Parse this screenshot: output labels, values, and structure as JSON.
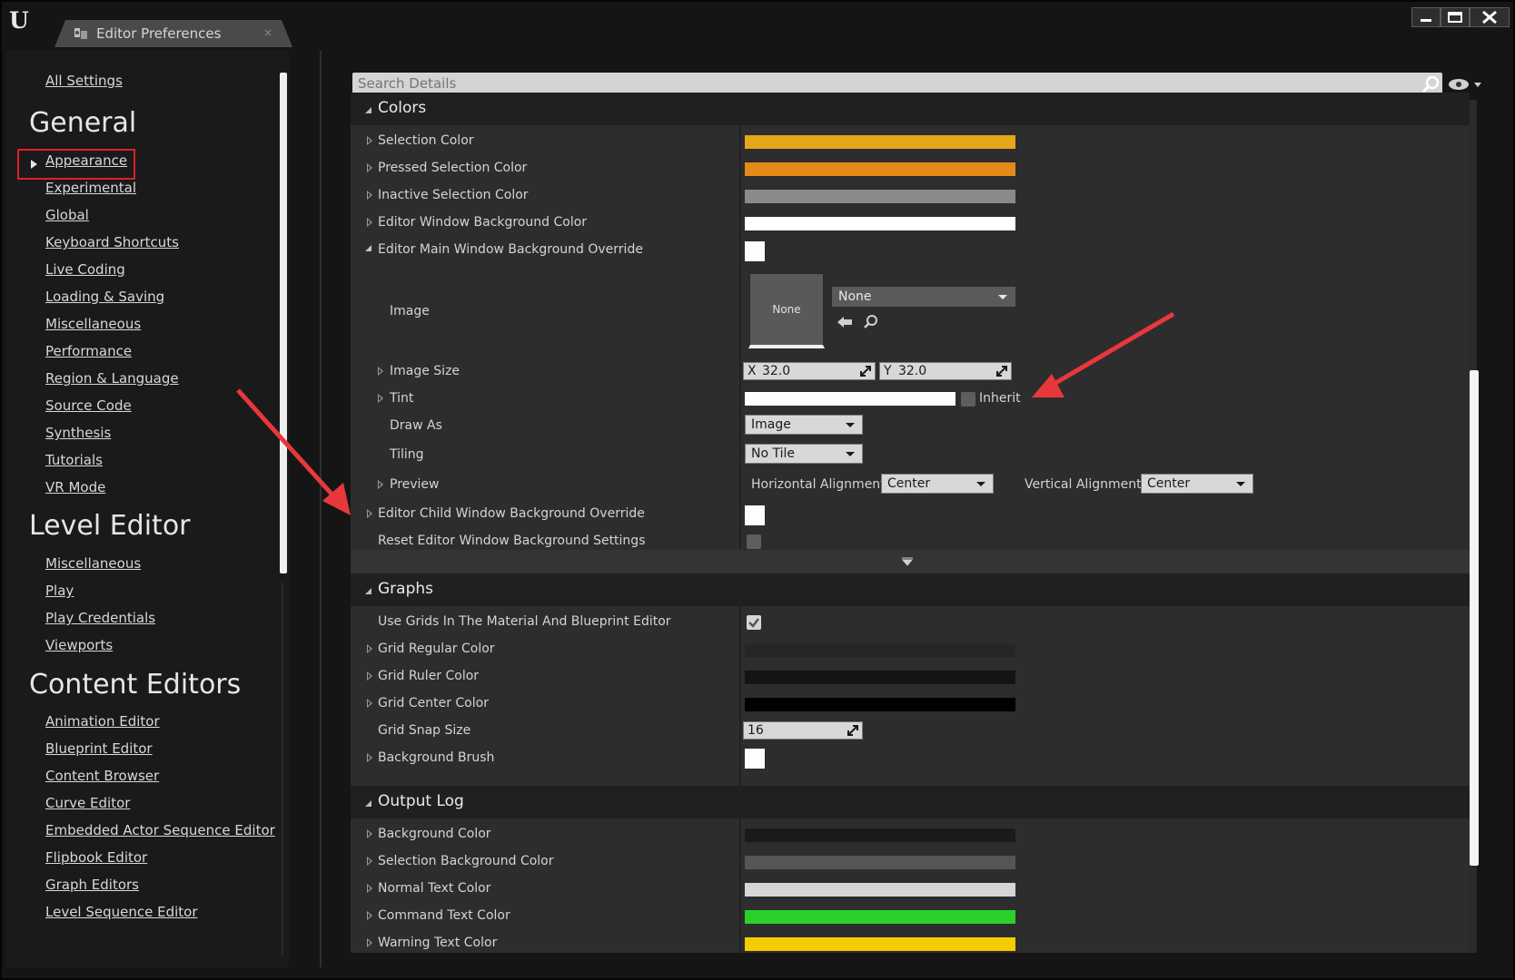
{
  "window": {
    "tab_title": "Editor Preferences",
    "tab_close": "×"
  },
  "search": {
    "placeholder": "Search Details"
  },
  "sidebar": {
    "all_settings": "All Settings",
    "sections": [
      {
        "heading": "General",
        "items": [
          "Appearance",
          "Experimental",
          "Global",
          "Keyboard Shortcuts",
          "Live Coding",
          "Loading & Saving",
          "Miscellaneous",
          "Performance",
          "Region & Language",
          "Source Code",
          "Synthesis",
          "Tutorials",
          "VR Mode"
        ]
      },
      {
        "heading": "Level Editor",
        "items": [
          "Miscellaneous",
          "Play",
          "Play Credentials",
          "Viewports"
        ]
      },
      {
        "heading": "Content Editors",
        "items": [
          "Animation Editor",
          "Blueprint Editor",
          "Content Browser",
          "Curve Editor",
          "Embedded Actor Sequence Editor",
          "Flipbook Editor",
          "Graph Editors",
          "Level Sequence Editor"
        ]
      }
    ],
    "selected": "Appearance"
  },
  "colors": {
    "title": "Colors",
    "selection_color": {
      "label": "Selection Color",
      "value": "#e5a71a"
    },
    "pressed_selection_color": {
      "label": "Pressed Selection Color",
      "value": "#e38a18"
    },
    "inactive_selection_color": {
      "label": "Inactive Selection Color",
      "value": "#8a8a8a"
    },
    "window_bg_color": {
      "label": "Editor Window Background Color",
      "value": "#ffffff"
    },
    "main_override": {
      "label": "Editor Main Window Background Override",
      "value": "#ffffff"
    },
    "image": {
      "label": "Image",
      "thumb": "None",
      "combo": "None"
    },
    "image_size": {
      "label": "Image Size",
      "x_label": "X",
      "x": "32.0",
      "y_label": "Y",
      "y": "32.0"
    },
    "tint": {
      "label": "Tint",
      "value": "#ffffff",
      "inherit": "Inherit"
    },
    "draw_as": {
      "label": "Draw As",
      "value": "Image"
    },
    "tiling": {
      "label": "Tiling",
      "value": "No Tile"
    },
    "preview": {
      "label": "Preview",
      "h_label": "Horizontal Alignment",
      "h_value": "Center",
      "v_label": "Vertical Alignment",
      "v_value": "Center"
    },
    "child_override": {
      "label": "Editor Child Window Background Override",
      "value": "#ffffff"
    },
    "reset": {
      "label": "Reset Editor Window Background Settings"
    }
  },
  "graphs": {
    "title": "Graphs",
    "use_grids": {
      "label": "Use Grids In The Material And Blueprint Editor",
      "checked": true
    },
    "grid_regular": {
      "label": "Grid Regular Color",
      "value": "#262626"
    },
    "grid_ruler": {
      "label": "Grid Ruler Color",
      "value": "#141414"
    },
    "grid_center": {
      "label": "Grid Center Color",
      "value": "#000000"
    },
    "grid_snap": {
      "label": "Grid Snap Size",
      "value": "16"
    },
    "bg_brush": {
      "label": "Background Brush",
      "value": "#ffffff"
    }
  },
  "output_log": {
    "title": "Output Log",
    "bg_color": {
      "label": "Background Color",
      "value": "#1a1a1a"
    },
    "sel_bg_color": {
      "label": "Selection Background Color",
      "value": "#555555"
    },
    "normal_text": {
      "label": "Normal Text Color",
      "value": "#d6d6d6"
    },
    "command_text": {
      "label": "Command Text Color",
      "value": "#2ad12a"
    },
    "warning_text": {
      "label": "Warning Text Color",
      "value": "#f5cc00"
    }
  },
  "annotations": {
    "arrow_color": "#e8383b"
  }
}
